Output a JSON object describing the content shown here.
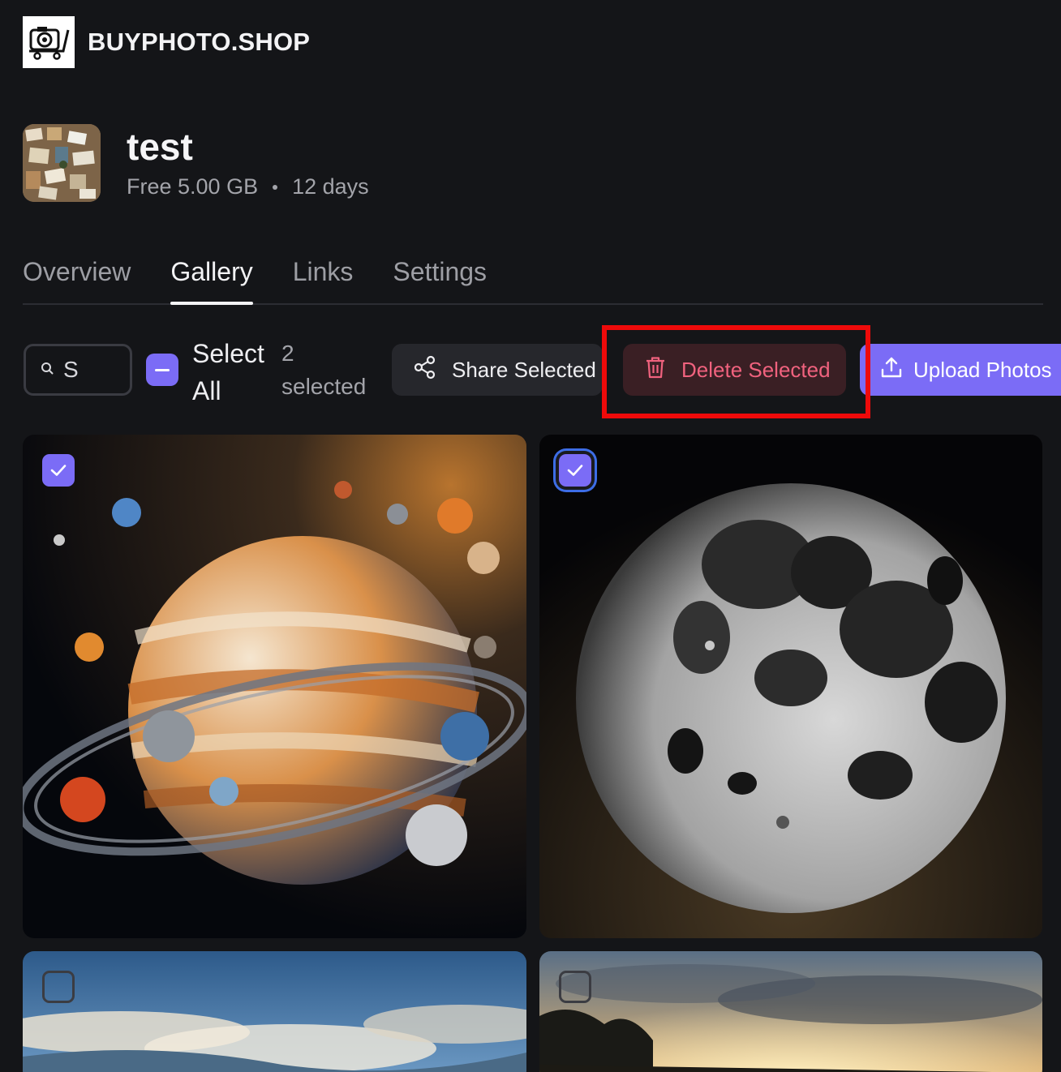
{
  "header": {
    "brand": "BUYPHOTO.SHOP",
    "logo_icon": "camera-cart-icon"
  },
  "album": {
    "title": "test",
    "storage": "Free 5.00 GB",
    "expires": "12 days"
  },
  "tabs": [
    {
      "label": "Overview",
      "active": false
    },
    {
      "label": "Gallery",
      "active": true
    },
    {
      "label": "Links",
      "active": false
    },
    {
      "label": "Settings",
      "active": false
    }
  ],
  "toolbar": {
    "search_value": "S",
    "select_all_label": "Select All",
    "selected_count": "2 selected",
    "share_label": "Share Selected",
    "delete_label": "Delete Selected",
    "upload_label": "Upload Photos"
  },
  "gallery": [
    {
      "subject": "planets",
      "selected": true
    },
    {
      "subject": "moon",
      "selected": true
    },
    {
      "subject": "sky-landscape",
      "selected": false
    },
    {
      "subject": "sunset-tree",
      "selected": false
    }
  ],
  "colors": {
    "accent": "#7b6cf6",
    "danger": "#f0627e",
    "highlight": "#ee0a0a",
    "background": "#141518"
  }
}
